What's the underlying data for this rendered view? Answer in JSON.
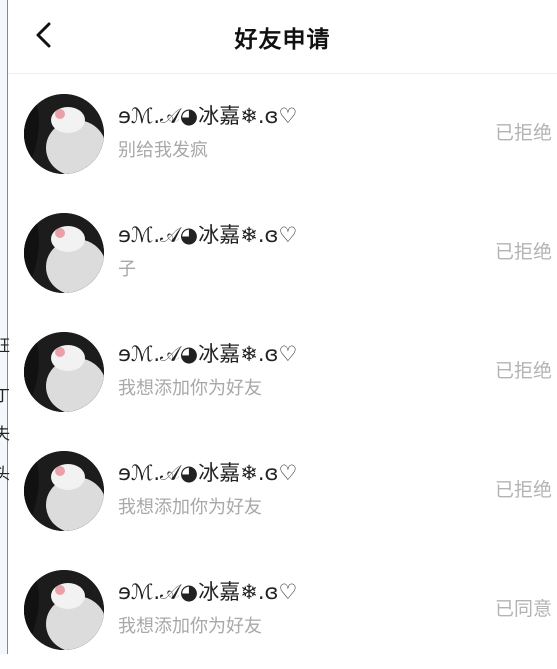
{
  "header": {
    "back_icon": "chevron-left-icon",
    "title": "好友申请"
  },
  "left_strip_chars": [
    "旺",
    "丁",
    "失",
    "头"
  ],
  "requests": [
    {
      "name": "ɘℳ.𝒜◕冰嘉❄.ɞ♡",
      "message": "别给我发疯",
      "status": "已拒绝"
    },
    {
      "name": "ɘℳ.𝒜◕冰嘉❄.ɞ♡",
      "message": "子",
      "status": "已拒绝"
    },
    {
      "name": "ɘℳ.𝒜◕冰嘉❄.ɞ♡",
      "message": "我想添加你为好友",
      "status": "已拒绝"
    },
    {
      "name": "ɘℳ.𝒜◕冰嘉❄.ɞ♡",
      "message": "我想添加你为好友",
      "status": "已拒绝"
    },
    {
      "name": "ɘℳ.𝒜◕冰嘉❄.ɞ♡",
      "message": "我想添加你为好友",
      "status": "已同意"
    }
  ]
}
